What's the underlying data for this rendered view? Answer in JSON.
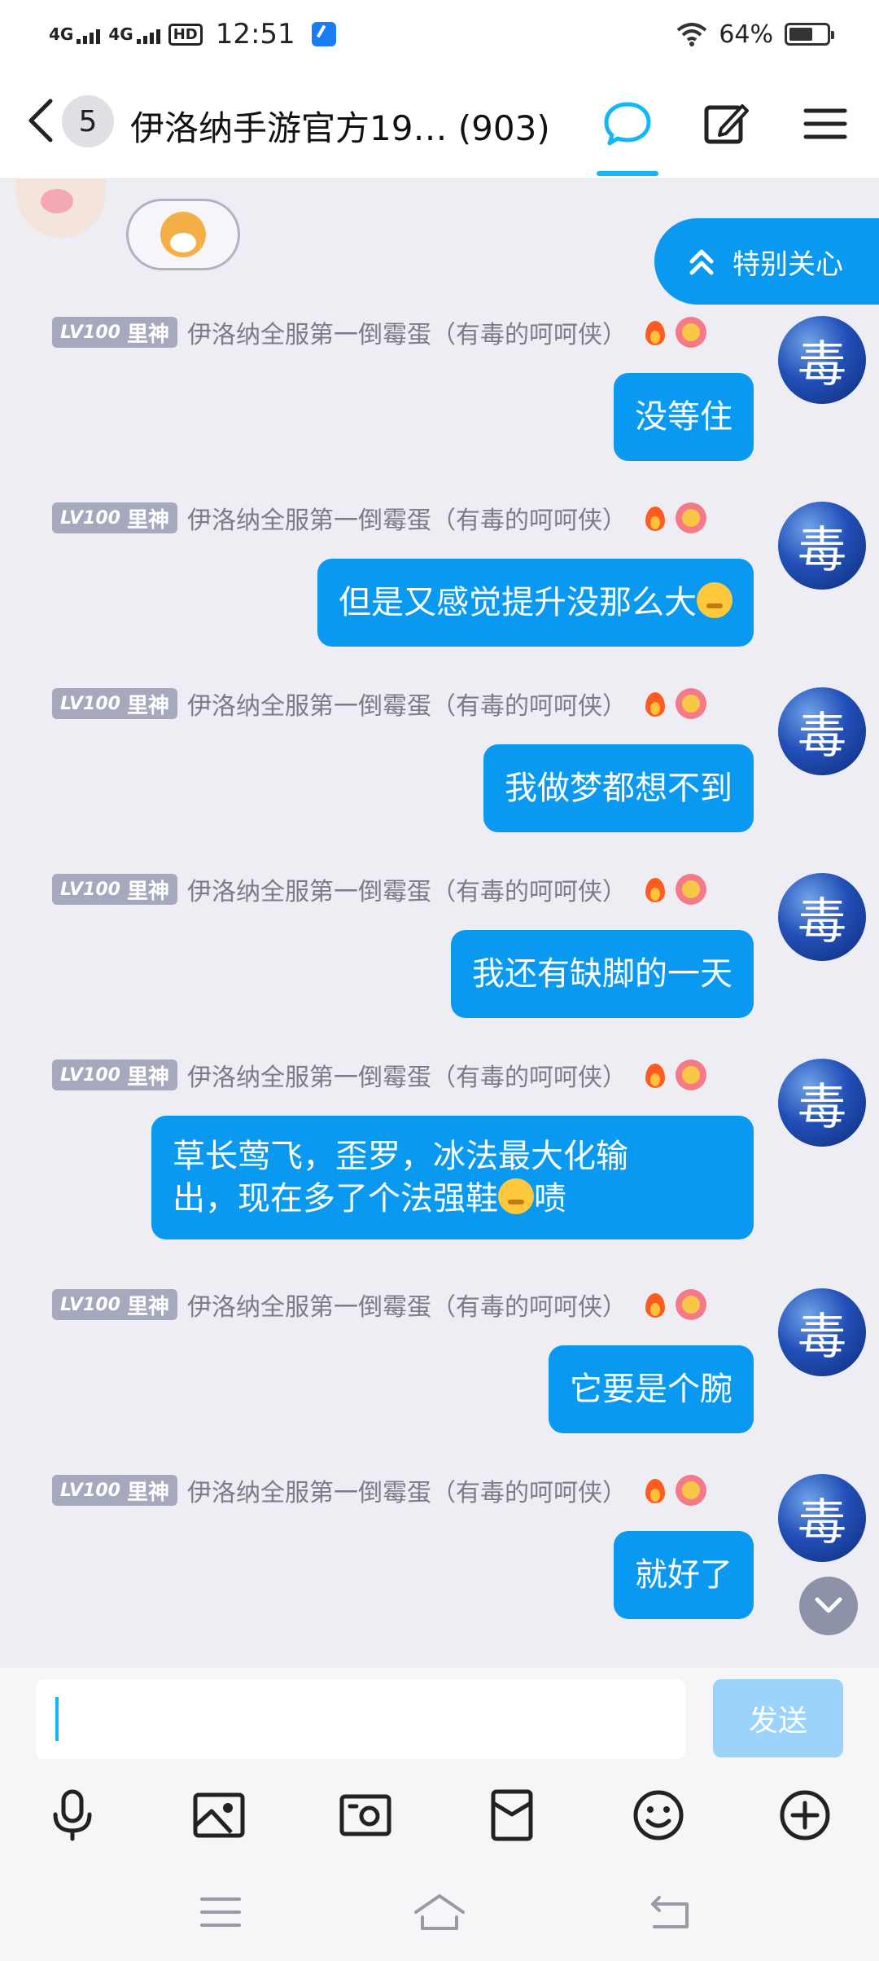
{
  "status_bar": {
    "net1": "4G",
    "net2": "4G",
    "hd": "HD",
    "time": "12:51",
    "battery": "64%",
    "battery_level": 0.64
  },
  "header": {
    "unread_count": "5",
    "title": "伊洛纳手游官方19… (903)"
  },
  "special_care": {
    "label": "特别关心"
  },
  "messages": [
    {
      "level": "LV100",
      "rank": "里神",
      "sender": "伊洛纳全服第一倒霉蛋（有毒的呵呵侠）",
      "avatar_char": "毒",
      "text": "没等住"
    },
    {
      "level": "LV100",
      "rank": "里神",
      "sender": "伊洛纳全服第一倒霉蛋（有毒的呵呵侠）",
      "avatar_char": "毒",
      "text": "但是又感觉提升没那么大"
    },
    {
      "level": "LV100",
      "rank": "里神",
      "sender": "伊洛纳全服第一倒霉蛋（有毒的呵呵侠）",
      "avatar_char": "毒",
      "text": "我做梦都想不到"
    },
    {
      "level": "LV100",
      "rank": "里神",
      "sender": "伊洛纳全服第一倒霉蛋（有毒的呵呵侠）",
      "avatar_char": "毒",
      "text": "我还有缺脚的一天"
    },
    {
      "level": "LV100",
      "rank": "里神",
      "sender": "伊洛纳全服第一倒霉蛋（有毒的呵呵侠）",
      "avatar_char": "毒",
      "text_line1": "草长莺飞，歪罗，冰法最大化输",
      "text_line2a": "出，现在多了个法强鞋",
      "text_line2b": "啧"
    },
    {
      "level": "LV100",
      "rank": "里神",
      "sender": "伊洛纳全服第一倒霉蛋（有毒的呵呵侠）",
      "avatar_char": "毒",
      "text": "它要是个腕"
    },
    {
      "level": "LV100",
      "rank": "里神",
      "sender": "伊洛纳全服第一倒霉蛋（有毒的呵呵侠）",
      "avatar_char": "毒",
      "text": "就好了"
    }
  ],
  "input": {
    "value": ""
  },
  "send_button": {
    "label": "发送"
  }
}
